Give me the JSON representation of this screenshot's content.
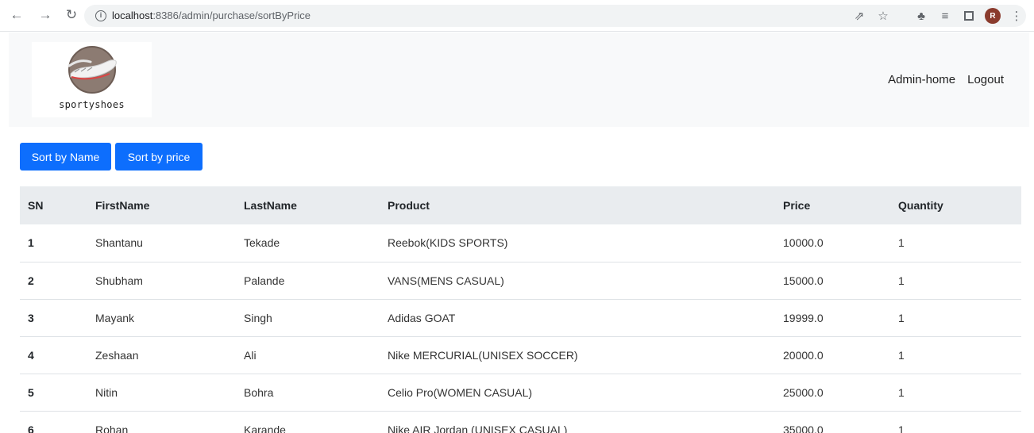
{
  "browser": {
    "url_prefix": "localhost",
    "url_rest": ":8386/admin/purchase/sortByPrice",
    "profile_initial": "R"
  },
  "header": {
    "logo_text": "sportyshoes",
    "nav": [
      "Admin-home",
      "Logout"
    ]
  },
  "buttons": {
    "sort_by_name": "Sort by Name",
    "sort_by_price": "Sort by price"
  },
  "table": {
    "columns": [
      "SN",
      "FirstName",
      "LastName",
      "Product",
      "Price",
      "Quantity"
    ],
    "rows": [
      [
        "1",
        "Shantanu",
        "Tekade",
        "Reebok(KIDS SPORTS)",
        "10000.0",
        "1"
      ],
      [
        "2",
        "Shubham",
        "Palande",
        "VANS(MENS CASUAL)",
        "15000.0",
        "1"
      ],
      [
        "3",
        "Mayank",
        "Singh",
        "Adidas GOAT",
        "19999.0",
        "1"
      ],
      [
        "4",
        "Zeshaan",
        "Ali",
        "Nike MERCURIAL(UNISEX SOCCER)",
        "20000.0",
        "1"
      ],
      [
        "5",
        "Nitin",
        "Bohra",
        "Celio Pro(WOMEN CASUAL)",
        "25000.0",
        "1"
      ],
      [
        "6",
        "Rohan",
        "Karande",
        "Nike AIR Jordan (UNISEX CASUAL)",
        "35000.0",
        "1"
      ]
    ]
  },
  "colors": {
    "primary_button": "#0d6efd",
    "header_bg": "#f8f9fa",
    "table_head_bg": "#e9ecef"
  }
}
